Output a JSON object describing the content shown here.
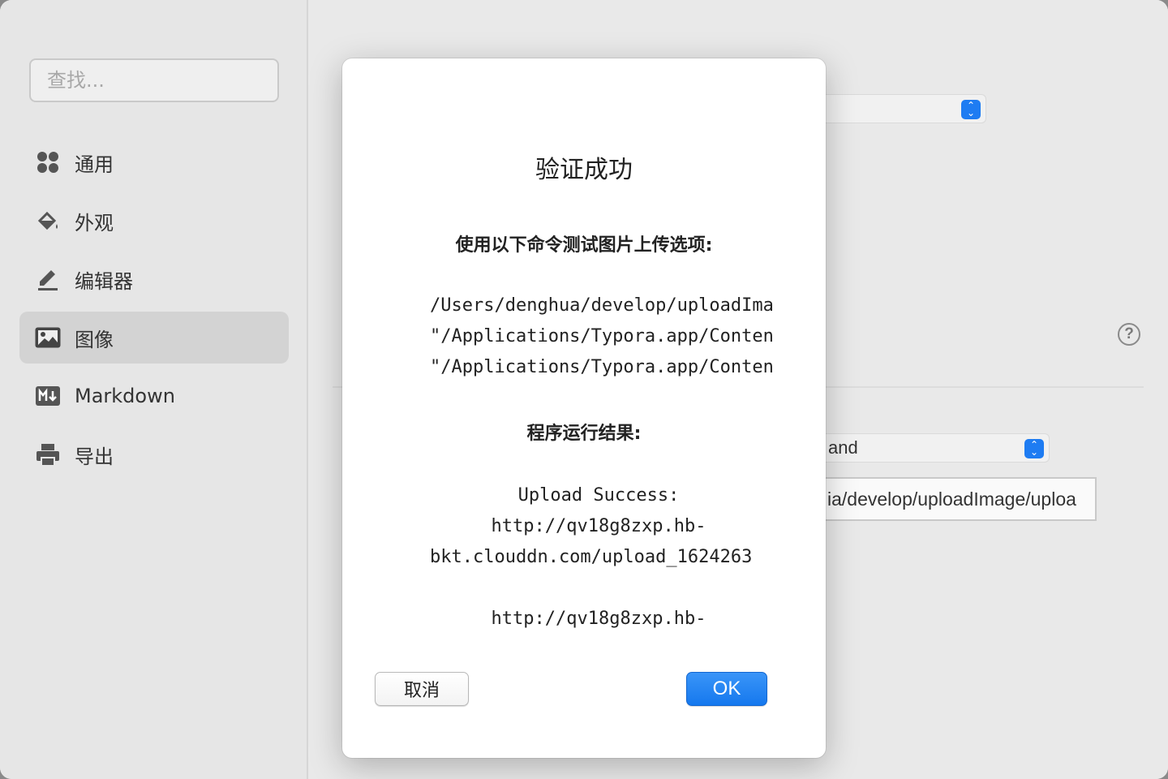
{
  "sidebar": {
    "search_placeholder": "查找...",
    "items": [
      {
        "label": "通用",
        "icon": "grid-icon",
        "active": false
      },
      {
        "label": "外观",
        "icon": "paint-bucket-icon",
        "active": false
      },
      {
        "label": "编辑器",
        "icon": "pencil-icon",
        "active": false
      },
      {
        "label": "图像",
        "icon": "image-icon",
        "active": true
      },
      {
        "label": "Markdown",
        "icon": "markdown-icon",
        "active": false
      },
      {
        "label": "导出",
        "icon": "printer-icon",
        "active": false
      }
    ]
  },
  "background": {
    "select_2_value": "and",
    "path_value": "ia/develop/uploadImage/uploa",
    "help_symbol": "?"
  },
  "dialog": {
    "title": "验证成功",
    "subtitle": "使用以下命令测试图片上传选项:",
    "command_lines": [
      "/Users/denghua/develop/uploadImage/upload",
      "\"/Applications/Typora.app/Contents/Resources",
      "\"/Applications/Typora.app/Contents/Resources"
    ],
    "result_label": "程序运行结果:",
    "result_lines": [
      "Upload Success:",
      "http://qv18g8zxp.hb-",
      "bkt.clouddn.com/upload_1624263",
      "",
      "http://qv18g8zxp.hb-"
    ],
    "cancel_label": "取消",
    "ok_label": "OK"
  },
  "colors": {
    "accent": "#1e7cf2",
    "close": "#fe5f57"
  }
}
